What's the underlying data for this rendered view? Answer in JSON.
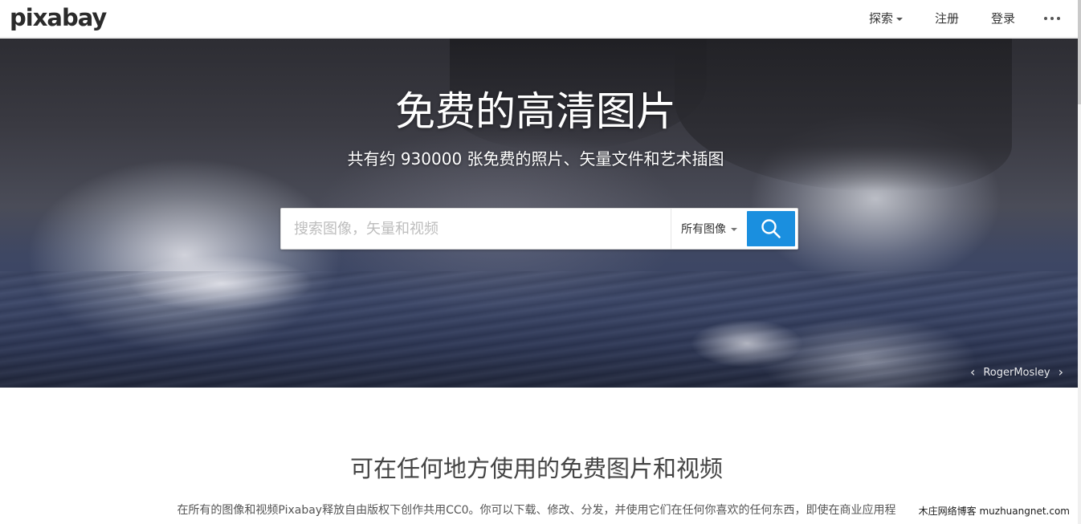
{
  "brand": {
    "logo_text": "pixabay"
  },
  "nav": {
    "explore": "探索",
    "register": "注册",
    "login": "登录"
  },
  "hero": {
    "title": "免费的高清图片",
    "subtitle": "共有约 930000 张免费的照片、矢量文件和艺术插图",
    "search": {
      "placeholder": "搜索图像，矢量和视频",
      "value": "",
      "type_selected": "所有图像"
    },
    "credit": {
      "prev_arrow": "‹",
      "photographer": "RogerMosley",
      "next_arrow": "›"
    }
  },
  "content": {
    "section_title": "可在任何地方使用的免费图片和视频",
    "section_desc": "在所有的图像和视频Pixabay释放自由版权下创作共用CC0。你可以下载、修改、分发，并使用它们在任何你喜欢的任何东西，即使在商业应用程"
  },
  "watermark": "木庄网络博客 muzhuangnet.com",
  "colors": {
    "accent": "#1a8fdf",
    "text_dark": "#333333"
  },
  "icons": {
    "search": "search-icon",
    "more": "more-dots-icon",
    "dropdown": "caret-down-icon"
  }
}
